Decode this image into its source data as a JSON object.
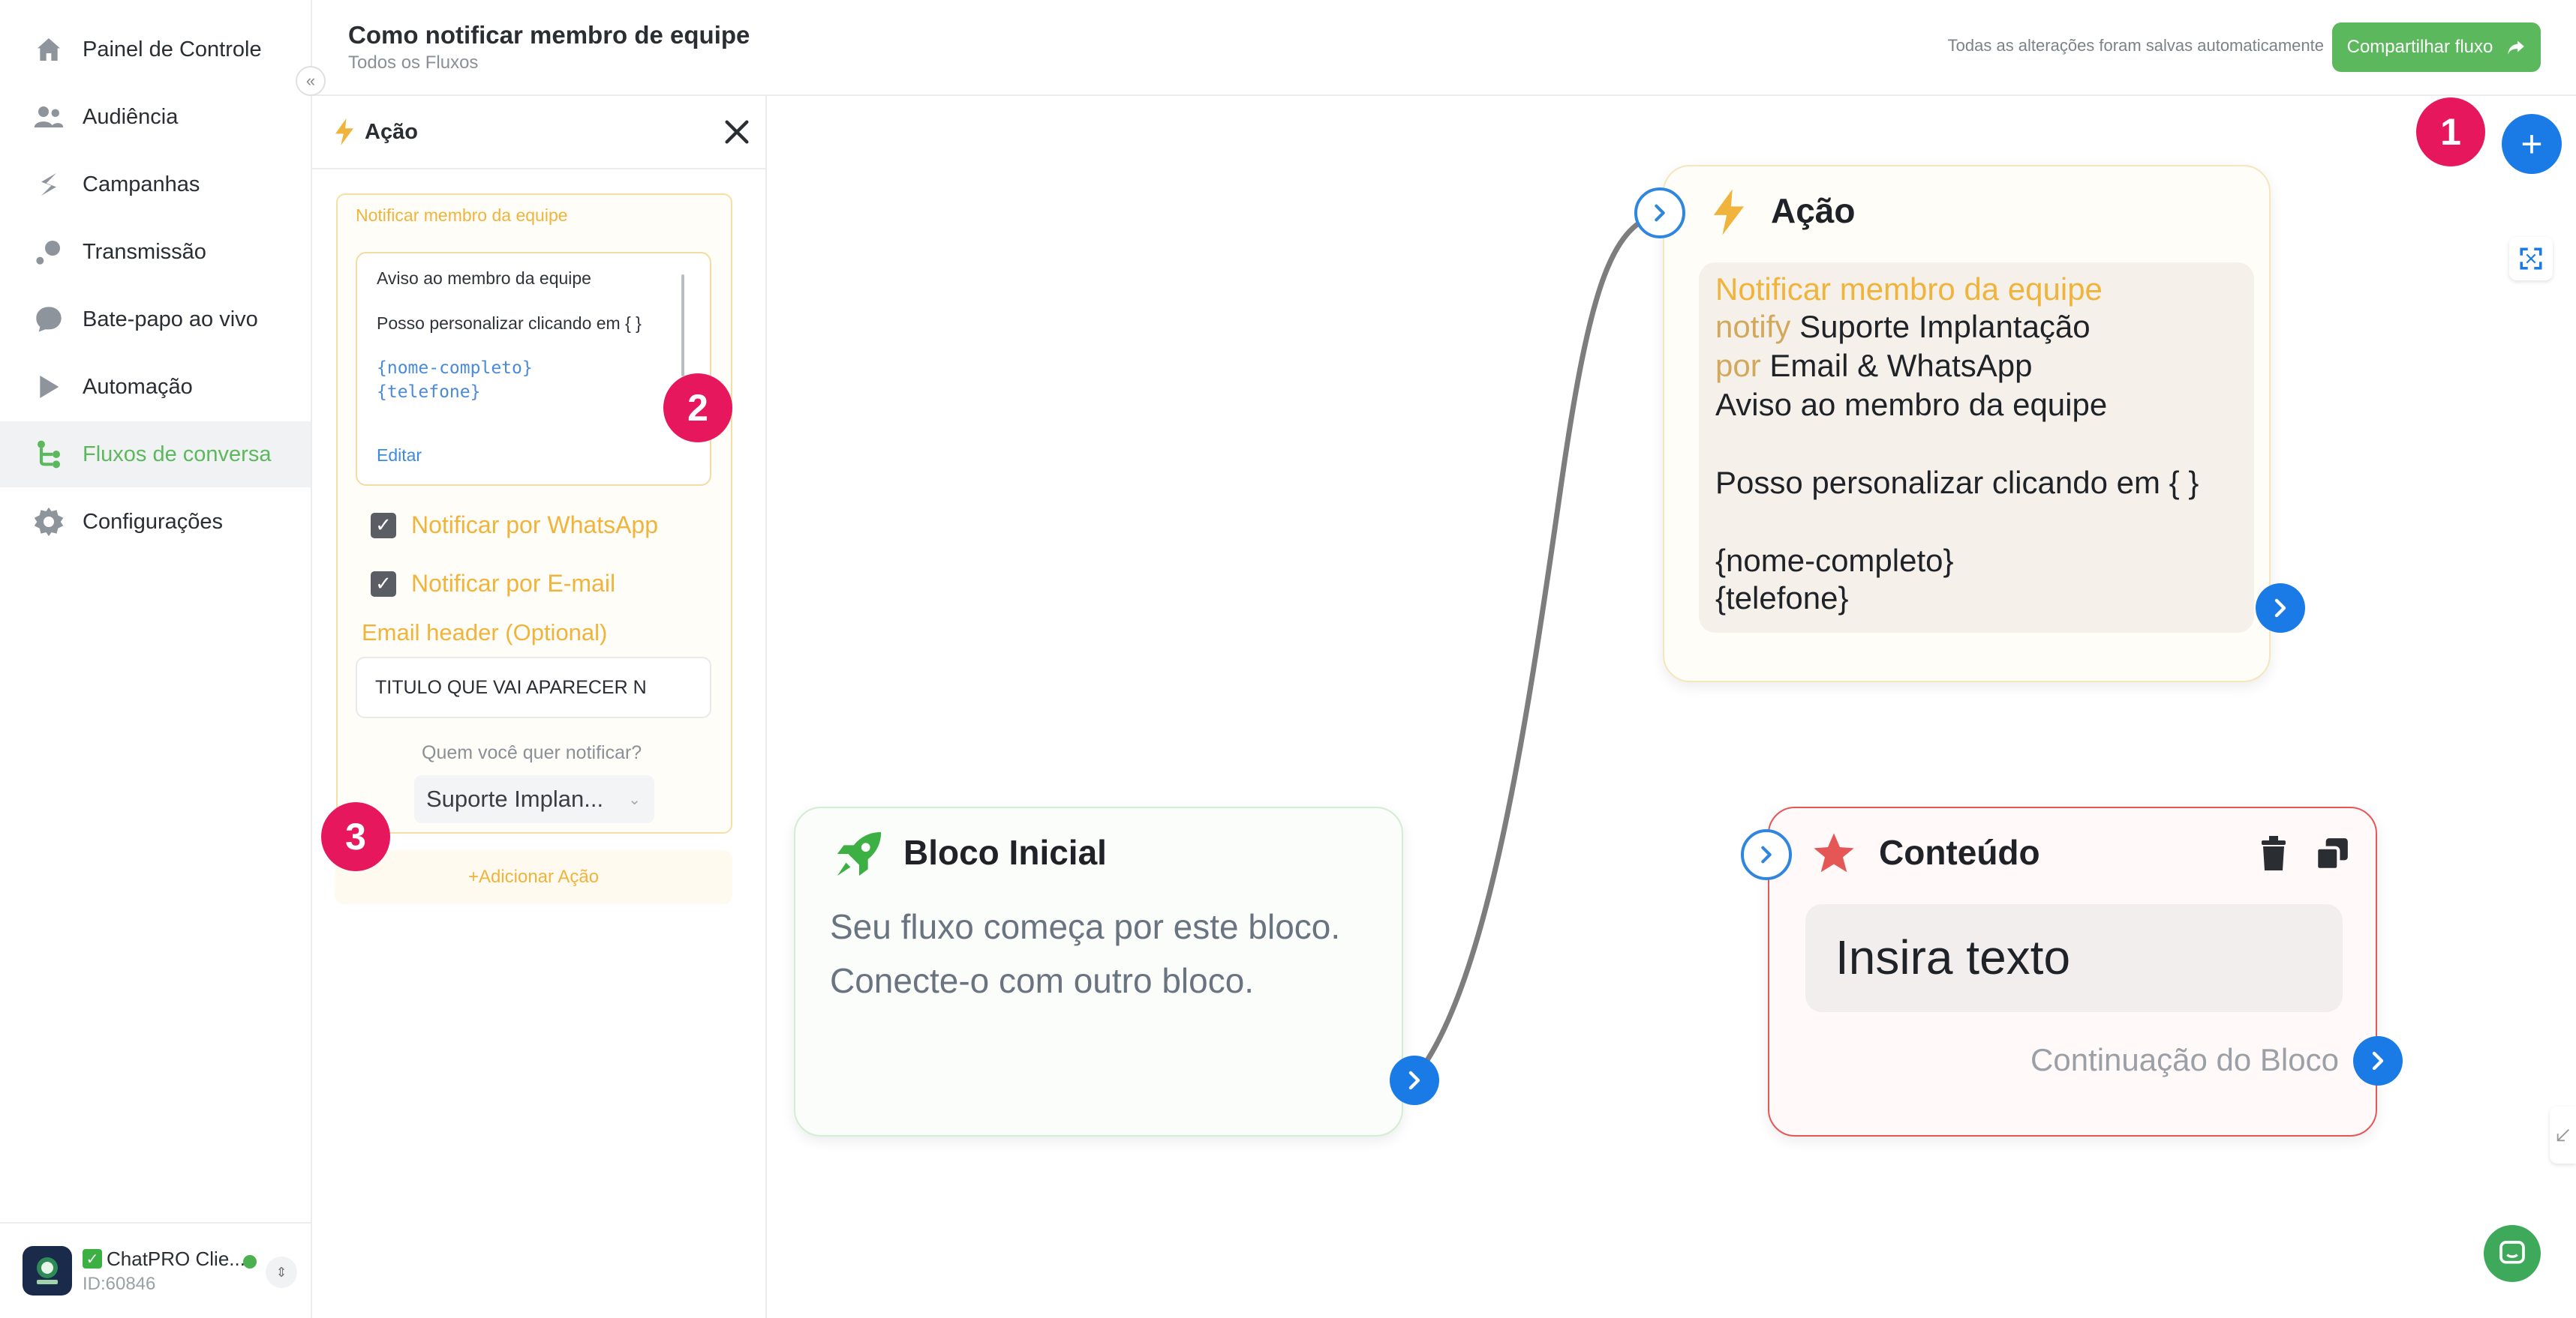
{
  "sidebar": {
    "items": [
      {
        "label": "Painel de Controle",
        "icon": "home-icon"
      },
      {
        "label": "Audiência",
        "icon": "users-icon"
      },
      {
        "label": "Campanhas",
        "icon": "campaign-icon"
      },
      {
        "label": "Transmissão",
        "icon": "broadcast-icon"
      },
      {
        "label": "Bate-papo ao vivo",
        "icon": "chat-bubble-icon"
      },
      {
        "label": "Automação",
        "icon": "play-icon"
      },
      {
        "label": "Fluxos de conversa",
        "icon": "flow-icon"
      },
      {
        "label": "Configurações",
        "icon": "gear-icon"
      }
    ],
    "active_item": "Fluxos de conversa",
    "collapse_glyph": "«",
    "profile": {
      "name": "ChatPRO Clie...",
      "id": "ID:60846",
      "status_color": "#4caf50"
    }
  },
  "header": {
    "title": "Como notificar membro de equipe",
    "breadcrumb": "Todos os Fluxos",
    "autosave": "Todas as alterações foram salvas automaticamente",
    "share_label": "Compartilhar fluxo"
  },
  "panel": {
    "title": "Ação",
    "card_title": "Notificar membro da equipe",
    "message": {
      "line1": "Aviso ao membro da equipe",
      "line2": "Posso personalizar clicando em { }",
      "var1": "{nome-completo}",
      "var2": "{telefone}",
      "edit": "Editar"
    },
    "notify_whatsapp": "Notificar por WhatsApp",
    "notify_email": "Notificar por E-mail",
    "email_header_label": "Email header (Optional)",
    "email_header_value": "TITULO QUE VAI APARECER N",
    "who_label": "Quem você quer notificar?",
    "who_value": "Suporte Implan...",
    "add_action": "+Adicionar Ação"
  },
  "canvas": {
    "start_node": {
      "title": "Bloco Inicial",
      "desc1": "Seu fluxo começa por este bloco.",
      "desc2": "Conecte-o com outro bloco."
    },
    "action_node": {
      "title": "Ação",
      "line1": "Notificar membro da equipe",
      "notify_prefix": "notify",
      "notify_target": "Suporte Implantação",
      "por_prefix": "por",
      "channels": "Email & WhatsApp",
      "line4": "Aviso ao membro da equipe",
      "line5": "Posso personalizar clicando em { }",
      "var1": "{nome-completo}",
      "var2": "{telefone}"
    },
    "content_node": {
      "title": "Conteúdo",
      "placeholder": "Insira texto",
      "continuation": "Continuação do Bloco"
    },
    "badges": [
      "1",
      "2",
      "3"
    ],
    "add_glyph": "+"
  },
  "colors": {
    "accent_green": "#5cb85c",
    "accent_blue": "#1a7be6",
    "badge_pink": "#e6175c",
    "action_yellow": "#f0b43c",
    "content_red": "#e55757"
  }
}
